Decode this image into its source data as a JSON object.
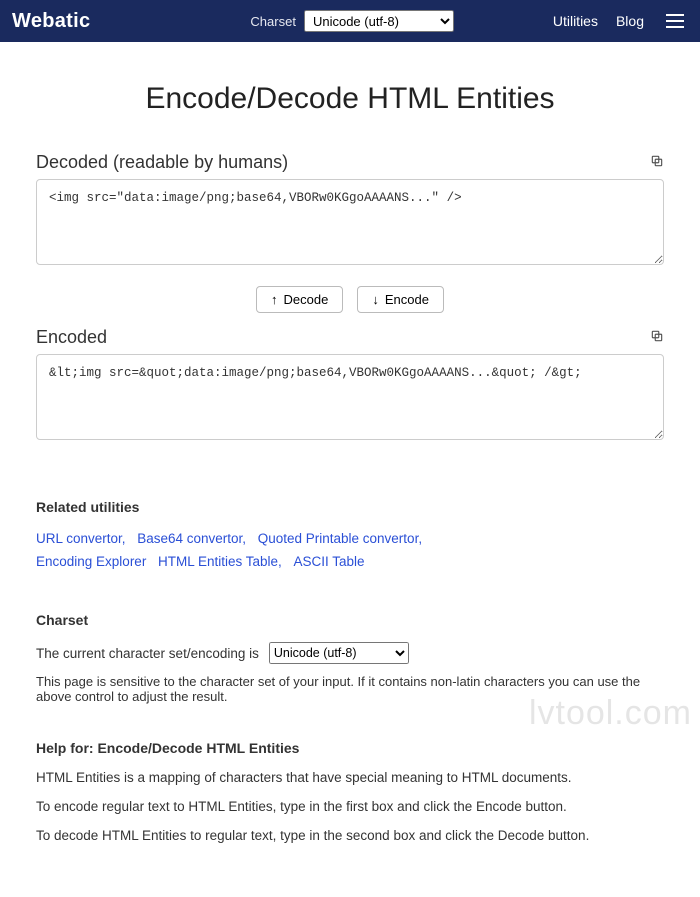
{
  "nav": {
    "brand": "Webatic",
    "charset_label": "Charset",
    "charset_selected": "Unicode (utf-8)",
    "utilities": "Utilities",
    "blog": "Blog"
  },
  "page_title": "Encode/Decode HTML Entities",
  "decoded": {
    "label": "Decoded (readable by humans)",
    "value": "<img src=\"data:image/png;base64,VBORw0KGgoAAAANS...\" />"
  },
  "buttons": {
    "decode": "Decode",
    "encode": "Encode"
  },
  "encoded": {
    "label": "Encoded",
    "value": "&lt;img src=&quot;data:image/png;base64,VBORw0KGgoAAAANS...&quot; /&gt;"
  },
  "related": {
    "heading": "Related utilities",
    "links": [
      "URL convertor,",
      "Base64 convertor,",
      "Quoted Printable convertor,",
      "Encoding Explorer",
      "HTML Entities Table,",
      "ASCII Table"
    ]
  },
  "charset_section": {
    "heading": "Charset",
    "prefix": "The current character set/encoding is",
    "selected": "Unicode (utf-8)",
    "note": "This page is sensitive to the character set of your input. If it contains non-latin characters you can use the above control to adjust the result."
  },
  "help": {
    "heading": "Help for: Encode/Decode HTML Entities",
    "p1": "HTML Entities is a mapping of characters that have special meaning to HTML documents.",
    "p2": "To encode regular text to HTML Entities, type in the first box and click the Encode button.",
    "p3": "To decode HTML Entities to regular text, type in the second box and click the Decode button."
  },
  "watermark": "lvtool.com"
}
